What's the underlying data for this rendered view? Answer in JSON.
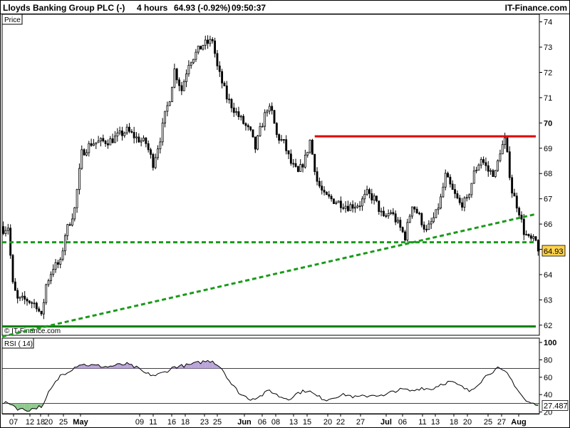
{
  "header": {
    "title": "Lloyds Banking Group PLC (-)",
    "interval": "4 hours",
    "price_change": "64.93 (-0.92%)",
    "time": "09:50:37",
    "brand": "IT-Finance.com"
  },
  "price_panel": {
    "label": "Price",
    "copyright": "© IT-Finance.com",
    "last_label": "64.93"
  },
  "rsi_panel": {
    "label": "RSI ( 14)",
    "last_label": "27.487"
  },
  "colors": {
    "up_candle": "#ffffff",
    "down_candle": "#000000",
    "resistance": "#e00000",
    "support": "#008000",
    "trend": "#1a9a1a",
    "rsi_line": "#000000",
    "rsi_overbought_fill": "#b9a4d8",
    "rsi_oversold_fill": "#8fc98f",
    "last_label_bg": "#ffd24d"
  },
  "chart_data": [
    {
      "type": "candlestick",
      "title": "Lloyds Banking Group PLC (-)",
      "ylabel": "Price",
      "ylim": [
        61.6,
        74.3
      ],
      "y_ticks": [
        62,
        63,
        64,
        65,
        66,
        67,
        68,
        69,
        70,
        71,
        72,
        73,
        74
      ],
      "y_ticks_bold": [
        70
      ],
      "x_tick_labels": [
        "07",
        "12",
        "18",
        "20",
        "25",
        "May",
        "09",
        "11",
        "16",
        "18",
        "23",
        "25",
        "Jun",
        "06",
        "08",
        "13",
        "15",
        "20",
        "22",
        "27",
        "Jul",
        "06",
        "11",
        "13",
        "18",
        "20",
        "25",
        "27",
        "Aug"
      ],
      "x_ticks_bold": [
        "May",
        "Jun",
        "Jul",
        "Aug"
      ],
      "last_price": 64.93,
      "overlays": [
        {
          "kind": "horizontal",
          "style": "solid",
          "color": "red",
          "y": 69.47,
          "x_from": "mid-June",
          "x_to": "end"
        },
        {
          "kind": "horizontal",
          "style": "solid",
          "color": "green",
          "y": 61.95,
          "x_from": "start",
          "x_to": "end"
        },
        {
          "kind": "horizontal",
          "style": "dashed",
          "color": "green",
          "y": 65.28,
          "x_from": "start",
          "x_to": "end"
        },
        {
          "kind": "trendline",
          "style": "dashed",
          "color": "green",
          "from": 61.55,
          "to": 66.38
        }
      ],
      "anchors": [
        [
          0,
          65.8
        ],
        [
          2,
          65.9
        ],
        [
          4,
          63.6
        ],
        [
          6,
          63.0
        ],
        [
          10,
          63.0
        ],
        [
          14,
          62.8
        ],
        [
          16,
          62.3
        ],
        [
          18,
          63.6
        ],
        [
          21,
          64.3
        ],
        [
          24,
          64.45
        ],
        [
          26,
          65.6
        ],
        [
          30,
          66.6
        ],
        [
          33,
          68.8
        ],
        [
          37,
          69.2
        ],
        [
          45,
          69.3
        ],
        [
          52,
          69.7
        ],
        [
          56,
          69.4
        ],
        [
          60,
          69.2
        ],
        [
          63,
          68.4
        ],
        [
          66,
          69.4
        ],
        [
          68,
          70.3
        ],
        [
          70,
          71.0
        ],
        [
          72,
          72.1
        ],
        [
          75,
          71.3
        ],
        [
          78,
          72.4
        ],
        [
          84,
          73.1
        ],
        [
          87,
          73.2
        ],
        [
          88,
          73.3
        ],
        [
          90,
          72.2
        ],
        [
          94,
          71.0
        ],
        [
          98,
          70.4
        ],
        [
          101,
          70.0
        ],
        [
          104,
          69.6
        ],
        [
          106,
          69.0
        ],
        [
          108,
          69.7
        ],
        [
          111,
          70.6
        ],
        [
          113,
          70.4
        ],
        [
          115,
          69.5
        ],
        [
          118,
          69.2
        ],
        [
          121,
          68.4
        ],
        [
          124,
          68.0
        ],
        [
          127,
          68.6
        ],
        [
          129,
          69.3
        ],
        [
          132,
          67.7
        ],
        [
          135,
          67.1
        ],
        [
          140,
          66.9
        ],
        [
          145,
          66.7
        ],
        [
          150,
          66.8
        ],
        [
          153,
          67.2
        ],
        [
          156,
          67.0
        ],
        [
          160,
          66.2
        ],
        [
          163,
          66.5
        ],
        [
          166,
          66.0
        ],
        [
          169,
          65.5
        ],
        [
          172,
          66.8
        ],
        [
          175,
          66.3
        ],
        [
          178,
          65.7
        ],
        [
          182,
          66.4
        ],
        [
          184,
          67.0
        ],
        [
          186,
          67.9
        ],
        [
          189,
          67.3
        ],
        [
          192,
          66.8
        ],
        [
          195,
          66.9
        ],
        [
          198,
          68.0
        ],
        [
          201,
          68.6
        ],
        [
          204,
          68.1
        ],
        [
          207,
          68.0
        ],
        [
          209,
          68.9
        ],
        [
          211,
          69.3
        ],
        [
          212,
          68.7
        ],
        [
          214,
          67.3
        ],
        [
          217,
          66.5
        ],
        [
          219,
          65.7
        ],
        [
          221,
          65.4
        ],
        [
          224,
          65.3
        ],
        [
          225,
          64.93
        ]
      ]
    },
    {
      "type": "line",
      "title": "RSI ( 14)",
      "ylim": [
        18,
        105
      ],
      "y_ticks": [
        20,
        40,
        60,
        80,
        100
      ],
      "y_ticks_bold": [
        100
      ],
      "reference_lines": [
        70,
        30
      ],
      "last_value": 27.487,
      "anchors": [
        [
          0,
          30
        ],
        [
          3,
          30
        ],
        [
          6,
          24
        ],
        [
          10,
          22
        ],
        [
          14,
          25
        ],
        [
          17,
          28
        ],
        [
          19,
          42
        ],
        [
          24,
          62
        ],
        [
          28,
          68
        ],
        [
          32,
          75
        ],
        [
          36,
          74
        ],
        [
          40,
          73
        ],
        [
          44,
          72
        ],
        [
          48,
          74
        ],
        [
          52,
          75
        ],
        [
          56,
          71
        ],
        [
          60,
          64
        ],
        [
          64,
          62
        ],
        [
          68,
          66
        ],
        [
          72,
          72
        ],
        [
          78,
          74
        ],
        [
          84,
          78
        ],
        [
          88,
          79
        ],
        [
          92,
          70
        ],
        [
          96,
          52
        ],
        [
          100,
          40
        ],
        [
          104,
          35
        ],
        [
          108,
          38
        ],
        [
          112,
          45
        ],
        [
          116,
          38
        ],
        [
          120,
          35
        ],
        [
          124,
          42
        ],
        [
          128,
          45
        ],
        [
          132,
          38
        ],
        [
          136,
          34
        ],
        [
          140,
          38
        ],
        [
          144,
          40
        ],
        [
          148,
          37
        ],
        [
          152,
          38
        ],
        [
          156,
          40
        ],
        [
          160,
          38
        ],
        [
          164,
          44
        ],
        [
          168,
          46
        ],
        [
          172,
          44
        ],
        [
          176,
          48
        ],
        [
          180,
          46
        ],
        [
          184,
          52
        ],
        [
          188,
          55
        ],
        [
          192,
          50
        ],
        [
          196,
          44
        ],
        [
          200,
          53
        ],
        [
          204,
          64
        ],
        [
          208,
          70
        ],
        [
          212,
          64
        ],
        [
          214,
          56
        ],
        [
          217,
          43
        ],
        [
          220,
          32
        ],
        [
          225,
          27.5
        ]
      ]
    }
  ]
}
